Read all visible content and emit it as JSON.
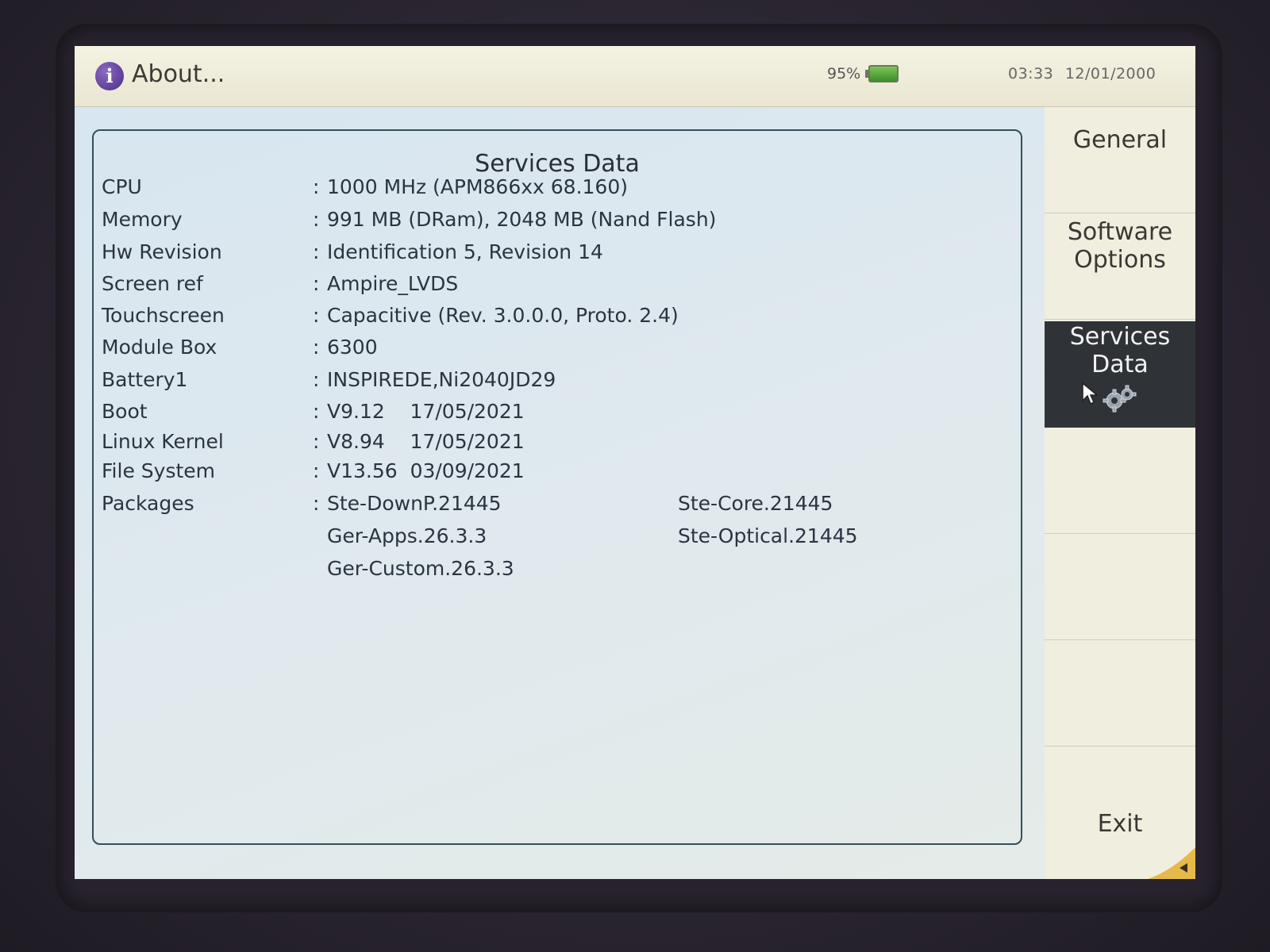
{
  "titlebar": {
    "title": "About...",
    "battery_percent": "95%",
    "time": "03:33",
    "date": "12/01/2000",
    "icon": "info-icon"
  },
  "panel": {
    "title": "Services Data",
    "rows": [
      {
        "label": "CPU",
        "value": "1000 MHz (APM866xx 68.160)"
      },
      {
        "label": "Memory",
        "value": "991 MB (DRam), 2048 MB (Nand Flash)"
      },
      {
        "label": "Hw Revision",
        "value": "Identification 5, Revision 14"
      },
      {
        "label": "Screen ref",
        "value": "Ampire_LVDS"
      },
      {
        "label": "Touchscreen",
        "value": "Capacitive  (Rev. 3.0.0.0, Proto. 2.4)"
      },
      {
        "label": "Module Box",
        "value": "6300"
      },
      {
        "label": "Battery1",
        "value": "INSPIREDE,Ni2040JD29"
      },
      {
        "label": "Boot",
        "value": "V9.12    17/05/2021"
      },
      {
        "label": "Linux Kernel",
        "value": "V8.94    17/05/2021"
      },
      {
        "label": "File System",
        "value": "V13.56  03/09/2021"
      },
      {
        "label": "Packages",
        "value": "Ste-DownP.21445"
      }
    ],
    "colon": ":",
    "packages": {
      "col1": [
        "Ger-Apps.26.3.3",
        "Ger-Custom.26.3.3"
      ],
      "col2": [
        "Ste-Core.21445",
        "Ste-Optical.21445"
      ]
    }
  },
  "sidebar": {
    "general": "General",
    "software_options_line1": "Software",
    "software_options_line2": "Options",
    "services_data_line1": "Services",
    "services_data_line2": "Data",
    "exit": "Exit"
  },
  "colors": {
    "active_tab_bg": "#2f3338",
    "panel_border": "#34505a",
    "main_bg": "#d7e6f0",
    "info_icon": "#4b2c84"
  }
}
